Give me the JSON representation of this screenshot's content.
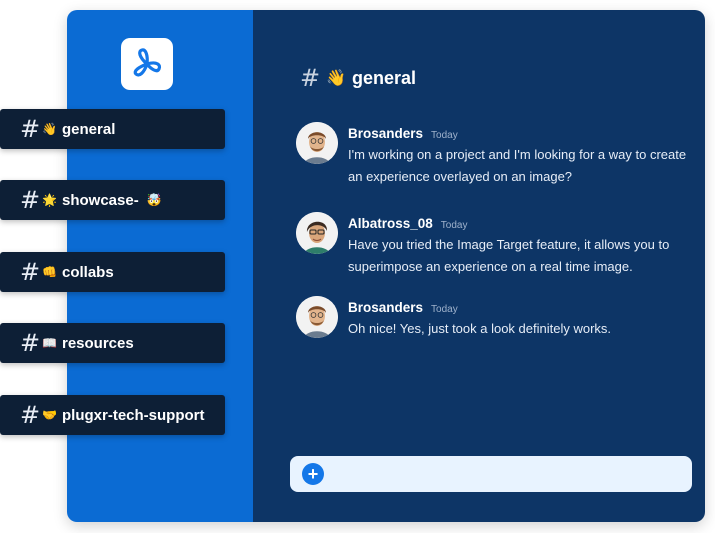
{
  "channels": [
    {
      "hash": "#",
      "emoji": "👋",
      "label": "general",
      "emoji_after": ""
    },
    {
      "hash": "#",
      "emoji": "🌟",
      "label": "showcase-",
      "emoji_after": "🤯"
    },
    {
      "hash": "#",
      "emoji": "👊",
      "label": "collabs",
      "emoji_after": ""
    },
    {
      "hash": "#",
      "emoji": "📖",
      "label": "resources",
      "emoji_after": ""
    },
    {
      "hash": "#",
      "emoji": "🤝",
      "label": "plugxr-tech-support",
      "emoji_after": ""
    }
  ],
  "header": {
    "hash": "#",
    "emoji": "👋",
    "title": "general"
  },
  "messages": [
    {
      "name": "Brosanders",
      "time": "Today",
      "text": "I'm working on a project and I'm looking for a way to create an experience overlayed on an image?"
    },
    {
      "name": "Albatross_08",
      "time": "Today",
      "text": "Have you tried the Image Target feature, it allows you to superimpose an experience on a real time image."
    },
    {
      "name": "Brosanders",
      "time": "Today",
      "text": "Oh nice! Yes, just took a look definitely works."
    }
  ],
  "composer": {
    "plus": "+",
    "placeholder": ""
  },
  "colors": {
    "sidebar": "#0b6bd3",
    "main": "#0d3566",
    "chip": "#0d1f36",
    "composer": "#e8f3ff",
    "accent": "#1477e8"
  }
}
